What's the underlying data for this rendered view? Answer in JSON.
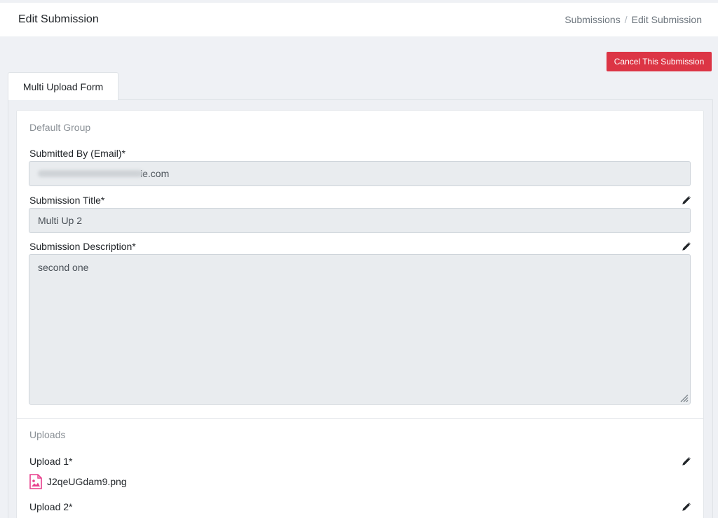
{
  "header": {
    "title": "Edit Submission",
    "breadcrumb": [
      "Submissions",
      "Edit Submission"
    ],
    "breadcrumb_separator": "/"
  },
  "actions": {
    "cancel_label": "Cancel This Submission",
    "cancel_color": "#dc3545"
  },
  "tabs": [
    {
      "label": "Multi Upload Form",
      "active": true
    }
  ],
  "default_group": {
    "title": "Default Group",
    "fields": {
      "email": {
        "label": "Submitted By (Email)*",
        "value_visible_suffix": "ie.com"
      },
      "title": {
        "label": "Submission Title*",
        "value": "Multi Up 2"
      },
      "description": {
        "label": "Submission Description*",
        "value": "second one"
      }
    }
  },
  "uploads": {
    "title": "Uploads",
    "items": [
      {
        "label": "Upload 1*",
        "file_name": "J2qeUGdam9.png",
        "file_icon": "image-file-icon",
        "icon_color": "#e83e8c"
      },
      {
        "label": "Upload 2*"
      }
    ]
  },
  "icons": {
    "edit": "pencil-icon"
  }
}
